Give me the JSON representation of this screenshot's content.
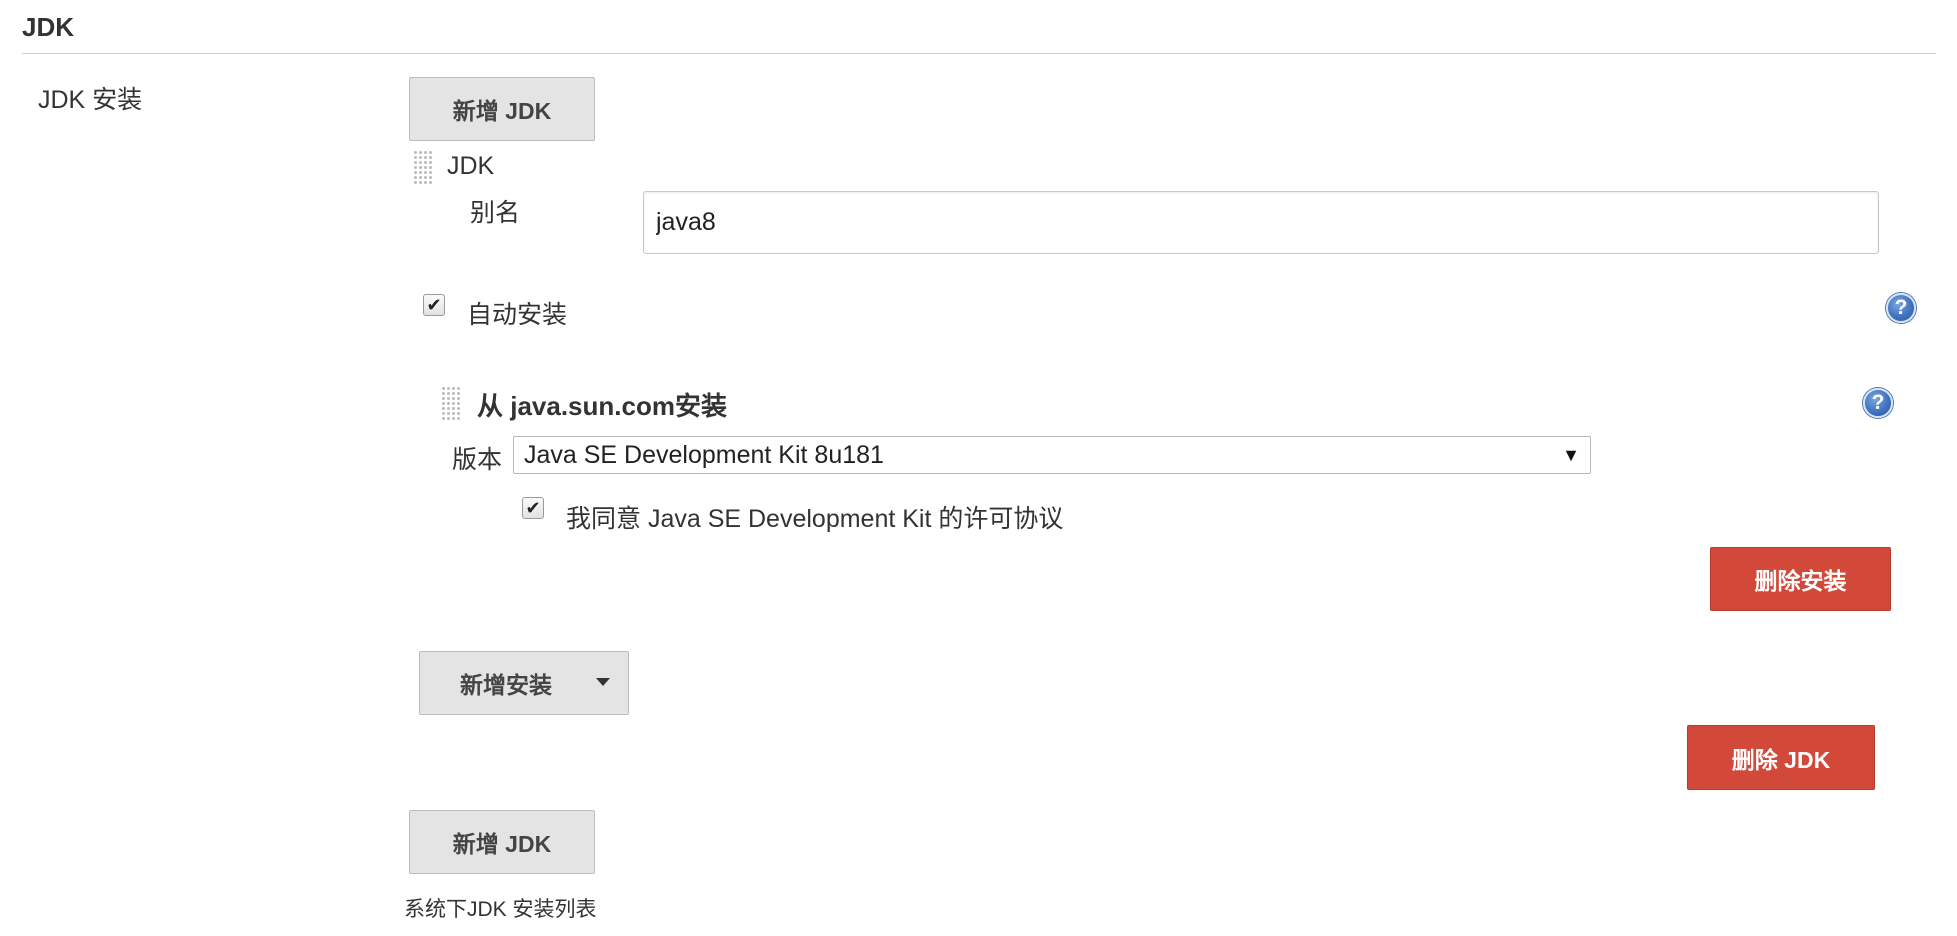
{
  "section": {
    "title": "JDK",
    "field_label": "JDK 安装",
    "add_jdk_label": "新增 JDK",
    "footer_description": "系统下JDK 安装列表"
  },
  "jdk_entry": {
    "heading": "JDK",
    "alias_label": "别名",
    "alias_value": "java8",
    "auto_install_label": "自动安装",
    "auto_install_checked": true,
    "delete_jdk_label": "删除 JDK",
    "add_installer_label": "新增安装"
  },
  "installer": {
    "heading": "从 java.sun.com安装",
    "version_label": "版本",
    "version_selected": "Java SE Development Kit 8u181",
    "license_label": "我同意 Java SE Development Kit 的许可协议",
    "license_checked": true,
    "delete_installer_label": "删除安装"
  },
  "icons": {
    "help": "help-icon",
    "drag": "drag-handle-icon",
    "checkmark": "checkmark-icon",
    "dropdown": "dropdown-arrow-icon"
  },
  "colors": {
    "danger": "#d24939",
    "neutral_button": "#e4e4e4",
    "help_blue": "#3f74c2"
  }
}
